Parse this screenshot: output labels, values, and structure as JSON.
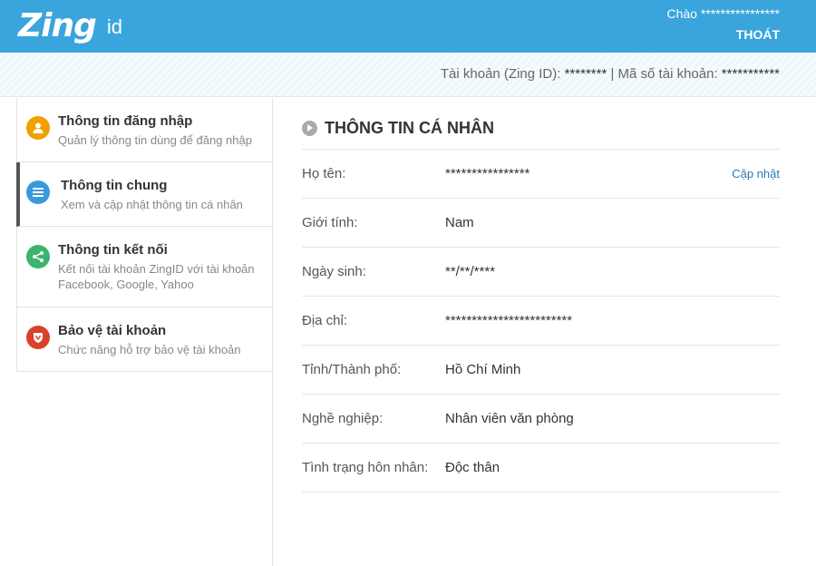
{
  "header": {
    "logo_word": "Zing",
    "logo_suffix": "id",
    "greeting": "Chào ****************",
    "logout_label": "THOÁT",
    "brand_color": "#3aa4dc",
    "logo_accent": "#e8296f"
  },
  "account_bar": {
    "label_account": "Tài khoản (Zing ID):",
    "account_value": "********",
    "separator": "|",
    "label_number": "Mã số tài khoản:",
    "number_value": "***********"
  },
  "sidebar": {
    "items": [
      {
        "title": "Thông tin đăng nhập",
        "desc": "Quản lý thông tin dùng để đăng nhập",
        "icon": "user-icon",
        "color": "#f0a000"
      },
      {
        "title": "Thông tin chung",
        "desc": "Xem và cập nhật thông tin cá nhân",
        "icon": "list-icon",
        "color": "#3a9ad9"
      },
      {
        "title": "Thông tin kết nối",
        "desc_line1": "Kết nối tài khoản ZingID với tài khoản",
        "desc_line2": "Facebook, Google, Yahoo",
        "icon": "share-icon",
        "color": "#3bb56e"
      },
      {
        "title": "Bảo vệ tài khoản",
        "desc": "Chức năng hỗ trợ bảo vệ tài khoản",
        "icon": "shield-icon",
        "color": "#d9412b"
      }
    ]
  },
  "main": {
    "section_title": "THÔNG TIN CÁ NHÂN",
    "update_label": "Cập nhật",
    "rows": [
      {
        "label": "Họ tên:",
        "value": "****************"
      },
      {
        "label": "Giới tính:",
        "value": "Nam"
      },
      {
        "label": "Ngày sinh:",
        "value": "**/**/****"
      },
      {
        "label": "Địa chỉ:",
        "value": "************************"
      },
      {
        "label": "Tỉnh/Thành phố:",
        "value": "Hồ Chí Minh"
      },
      {
        "label": "Nghề nghiệp:",
        "value": "Nhân viên văn phòng"
      },
      {
        "label": "Tình trạng hôn nhân:",
        "value": "Độc thân"
      }
    ]
  }
}
